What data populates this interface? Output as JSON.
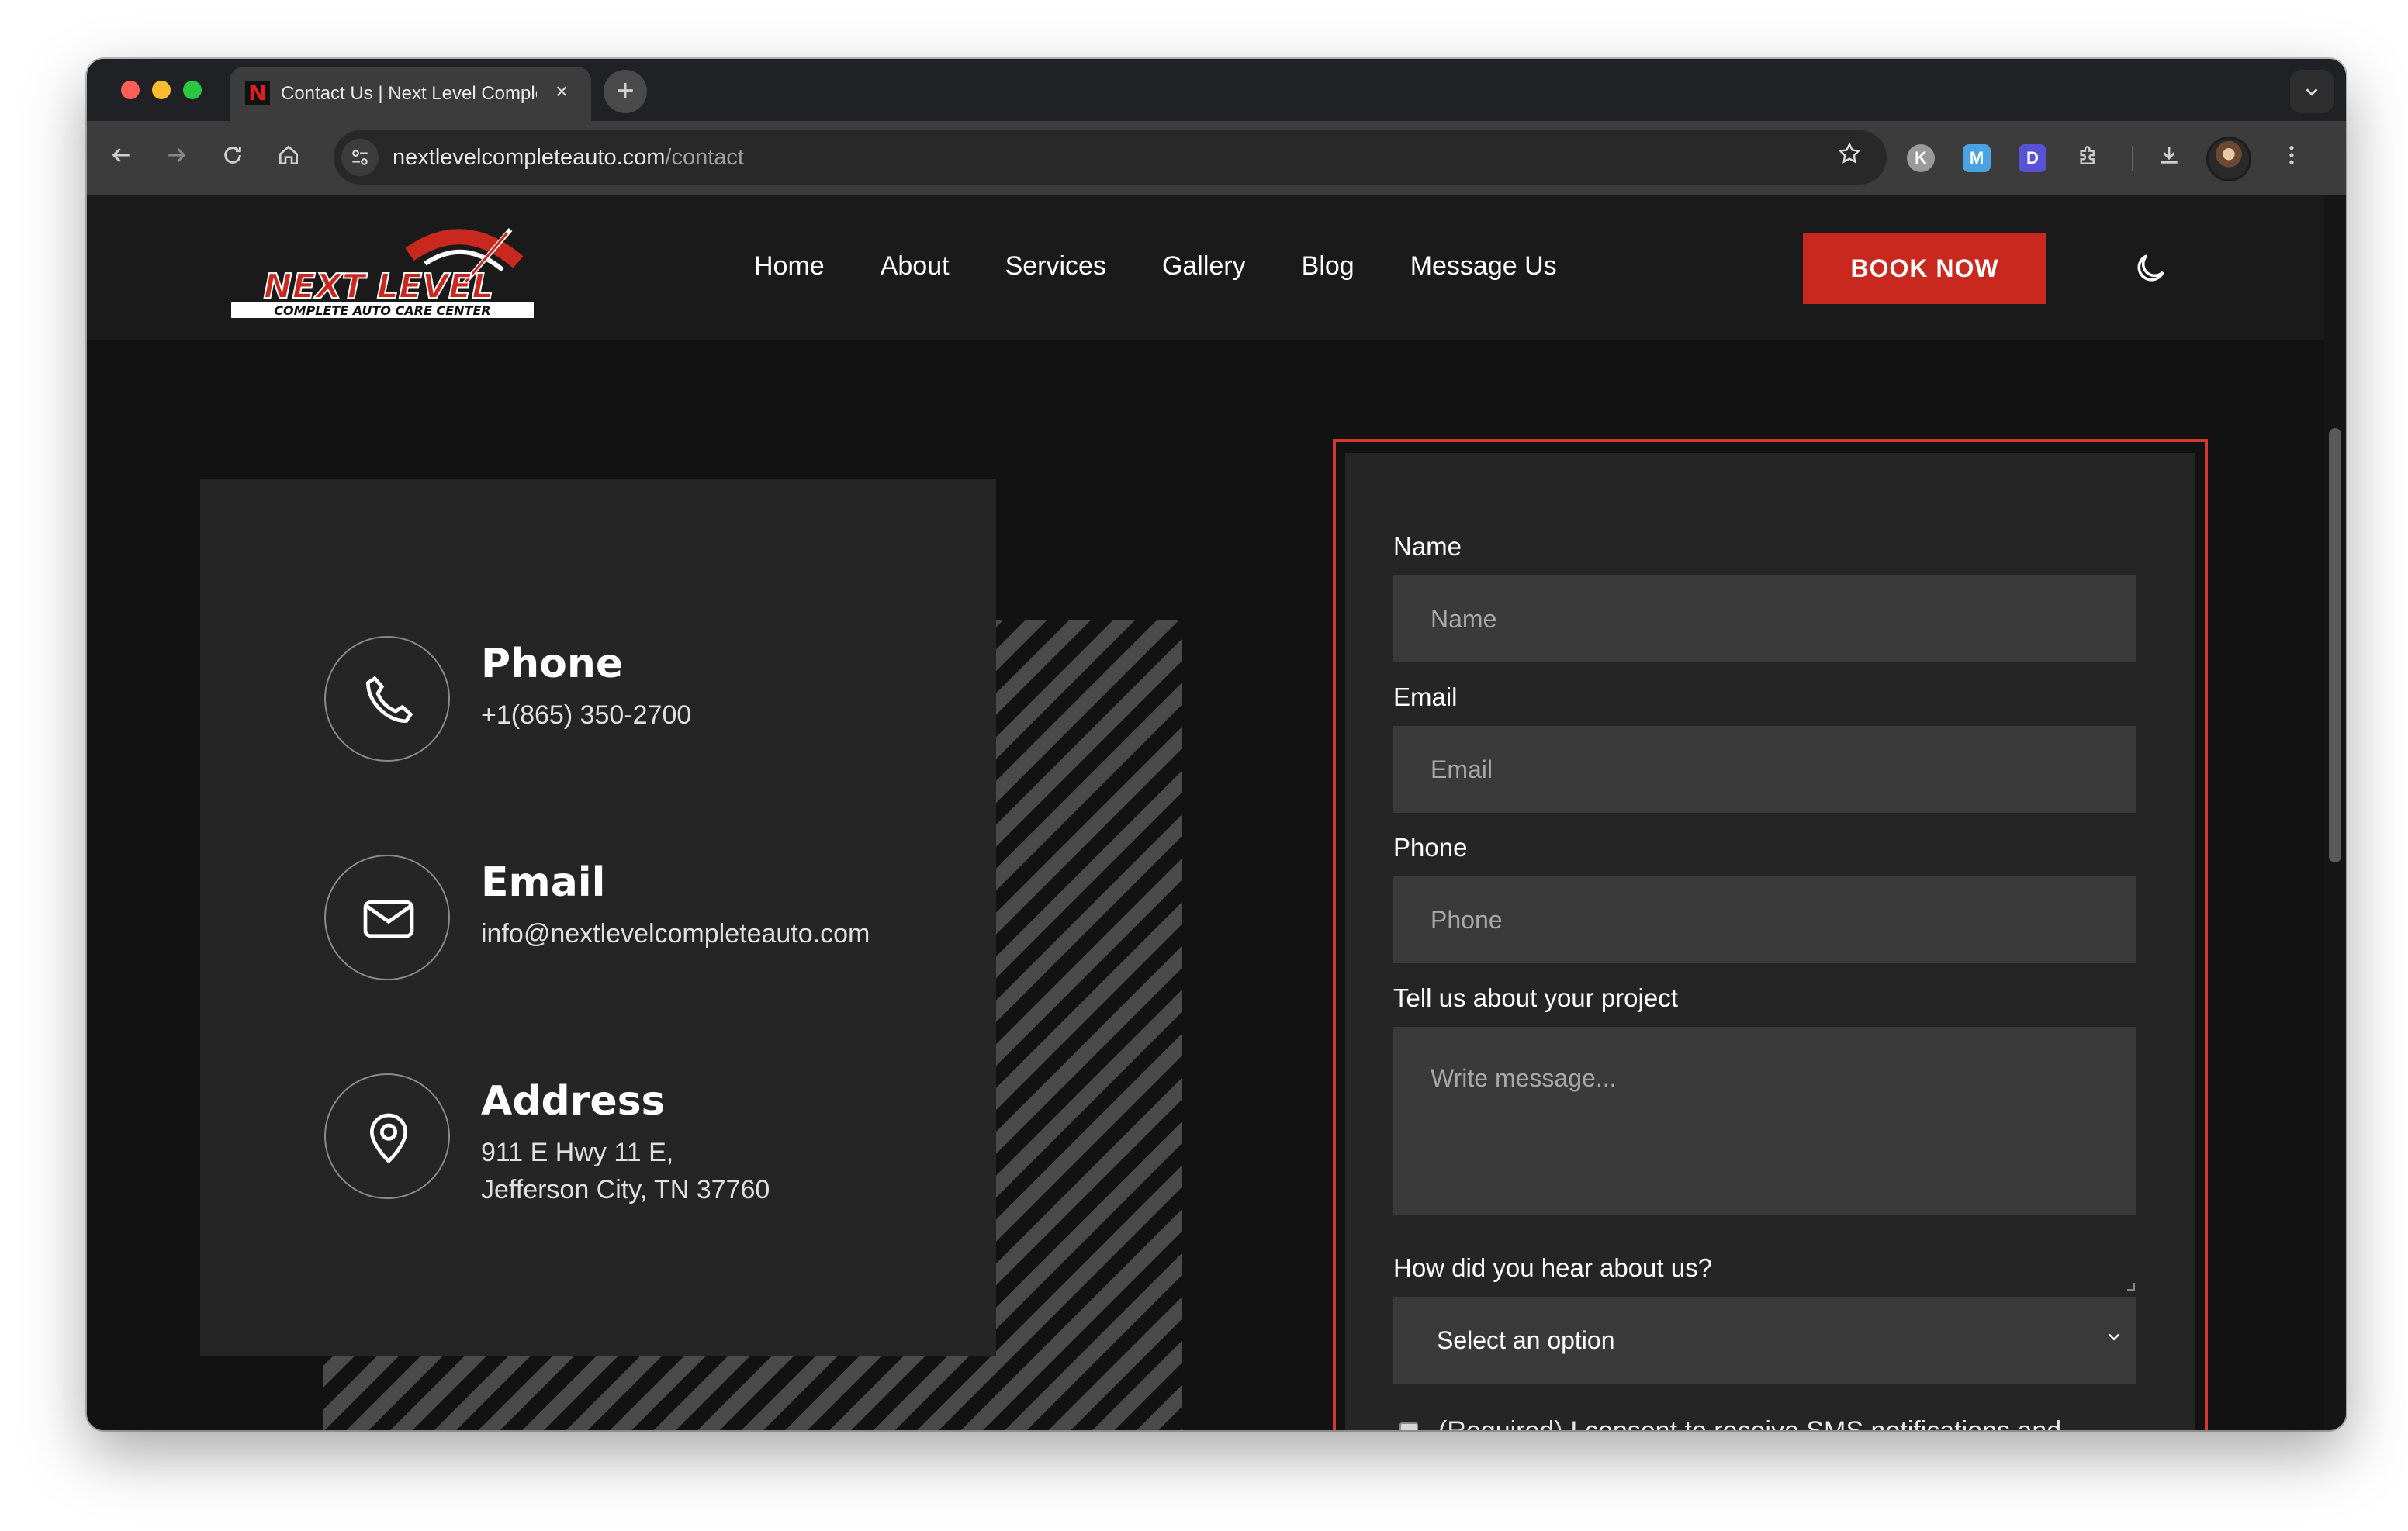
{
  "browser": {
    "tab_title": "Contact Us | Next Level Complete Auto Care Center",
    "tab_close": "×",
    "new_tab": "+",
    "url_domain": "nextlevelcompleteauto.com",
    "url_path": "/contact",
    "extensions": [
      "K",
      "M",
      "D"
    ]
  },
  "site": {
    "logo_text_main": "NEXT LEVEL",
    "logo_text_sub": "COMPLETE AUTO CARE CENTER",
    "nav": [
      "Home",
      "About",
      "Services",
      "Gallery",
      "Blog",
      "Message Us"
    ],
    "book_label": "BOOK NOW",
    "accent_color": "#c8281e"
  },
  "contact": {
    "phone_title": "Phone",
    "phone_value": "+1(865) 350-2700",
    "email_title": "Email",
    "email_value": "info@nextlevelcompleteauto.com",
    "address_title": "Address",
    "address_line1": "911 E Hwy 11 E,",
    "address_line2": "Jefferson City, TN 37760"
  },
  "form": {
    "name_label": "Name",
    "name_placeholder": "Name",
    "email_label": "Email",
    "email_placeholder": "Email",
    "phone_label": "Phone",
    "phone_placeholder": "Phone",
    "project_label": "Tell us about your project",
    "project_placeholder": "Write message...",
    "hear_label": "How did you hear about us?",
    "hear_selected": "Select an option",
    "consent_text": "(Required) I consent to receive SMS notifications and alerts from Next Level Complete Auto Care Center LLC"
  }
}
